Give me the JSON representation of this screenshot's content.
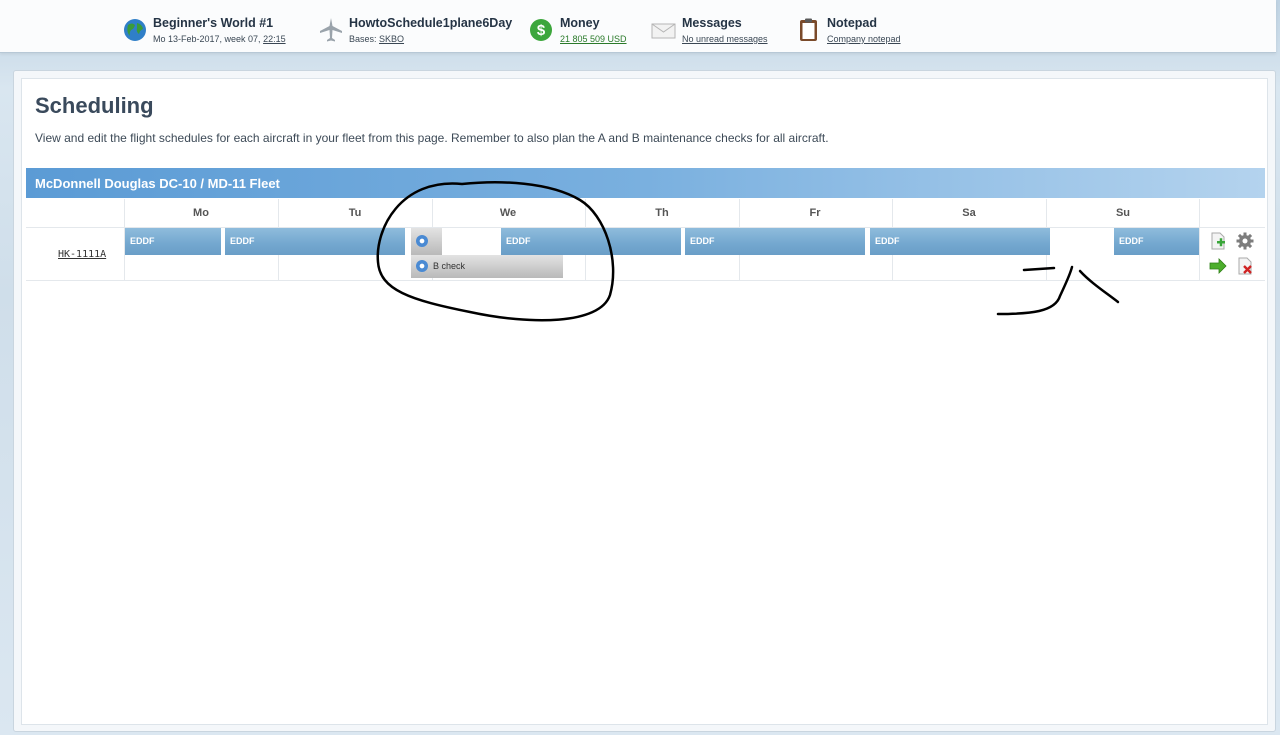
{
  "topbar": {
    "world": {
      "title": "Beginner's World #1",
      "date_text": "Mo 13-Feb-2017, week 07, ",
      "time": "22:15"
    },
    "airline": {
      "title": "HowtoSchedule1plane6Day",
      "bases_label": "Bases: ",
      "base": "SKBO"
    },
    "money": {
      "title": "Money",
      "amount": "21 805 509 USD"
    },
    "messages": {
      "title": "Messages",
      "status": "No unread messages"
    },
    "notepad": {
      "title": "Notepad",
      "link": "Company notepad"
    },
    "icons": [
      "globe-icon",
      "airplane-icon",
      "dollar-icon",
      "envelope-icon",
      "clipboard-icon"
    ]
  },
  "page": {
    "title": "Scheduling",
    "description": "View and edit the flight schedules for each aircraft in your fleet from this page. Remember to also plan the A and B maintenance checks for all aircraft."
  },
  "fleet": {
    "name": "McDonnell Douglas DC-10 / MD-11 Fleet",
    "days": [
      "Mo",
      "Tu",
      "We",
      "Th",
      "Fr",
      "Sa",
      "Su"
    ],
    "aircraft": [
      {
        "registration": "HK-1111A",
        "flights": [
          {
            "label": "EDDF"
          },
          {
            "label": "EDDF"
          },
          {
            "label": "EDDF"
          },
          {
            "label": "EDDF"
          },
          {
            "label": "EDDF"
          },
          {
            "label": "EDDF"
          }
        ],
        "maintenance": {
          "label": "B check"
        },
        "actions": [
          "add-flight-icon",
          "settings-gear-icon",
          "transfer-arrow-icon",
          "delete-icon"
        ]
      }
    ]
  },
  "colors": {
    "flight_bar": "#73a7cf",
    "fleet_header": "#5b9bd5",
    "money_green": "#2a7a2a"
  }
}
